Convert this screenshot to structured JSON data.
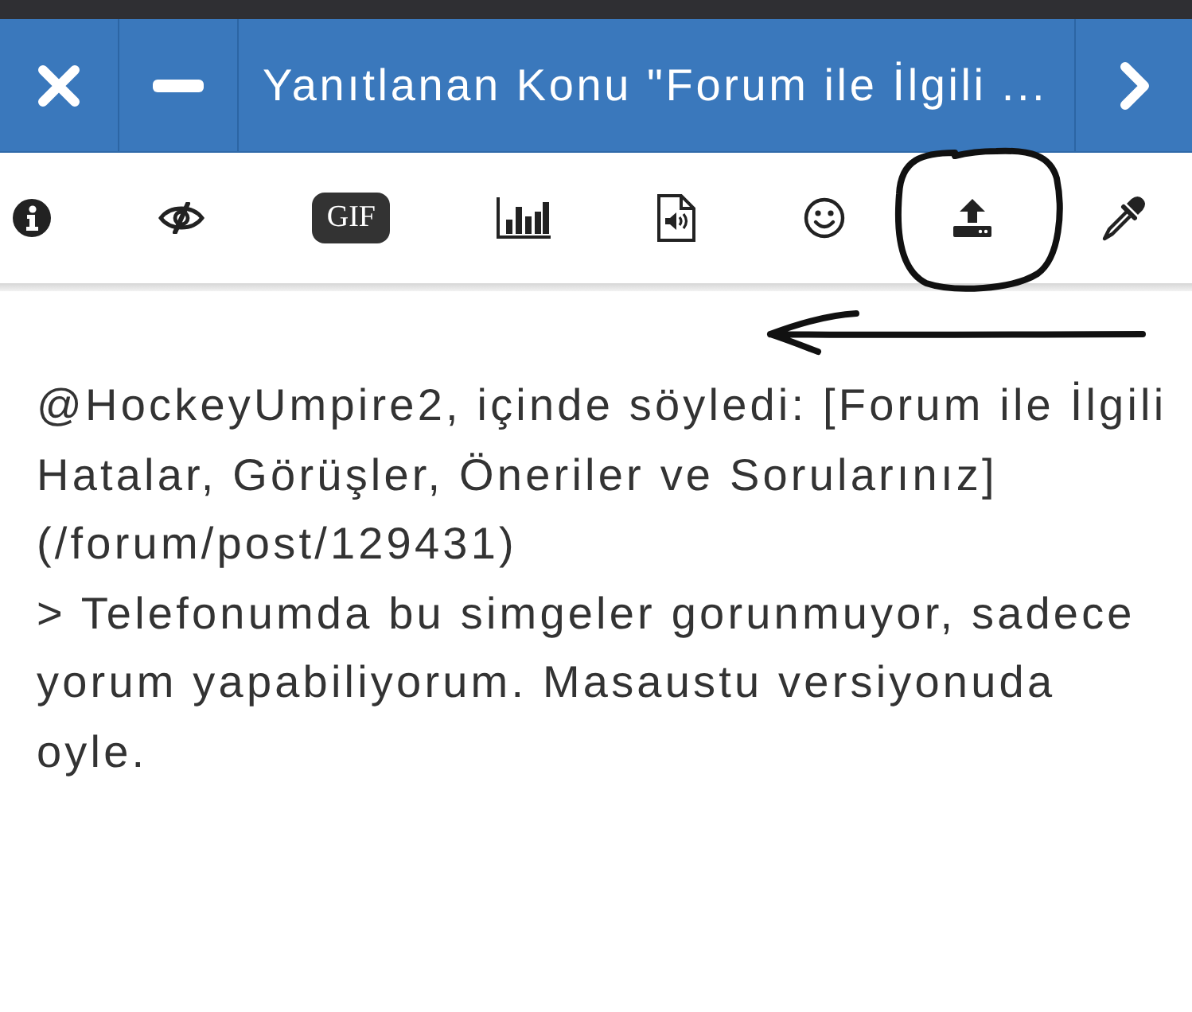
{
  "header": {
    "left_buttons": [
      {
        "kind": "close"
      },
      {
        "kind": "minimize"
      }
    ],
    "title": "Yanıtlanan Konu \"Forum ile İlgili ...",
    "right_buttons": [
      {
        "kind": "next"
      }
    ]
  },
  "toolbar": {
    "items": [
      {
        "kind": "info",
        "circled": false
      },
      {
        "kind": "hide",
        "circled": false
      },
      {
        "kind": "gif",
        "label": "GIF",
        "circled": false
      },
      {
        "kind": "poll",
        "circled": false
      },
      {
        "kind": "audio",
        "circled": false
      },
      {
        "kind": "emoji",
        "circled": false
      },
      {
        "kind": "upload",
        "circled": true
      },
      {
        "kind": "eyedropper",
        "circled": false
      }
    ]
  },
  "annotations": [
    {
      "kind": "arrow"
    }
  ],
  "message": {
    "value": "@HockeyUmpire2, içinde söyledi: [Forum ile İlgili Hatalar, Görüşler, Öneriler ve Sorularınız](/forum/post/129431)\n> Telefonumda bu simgeler gorunmuyor, sadece yorum yapabiliyorum. Masaustu versiyonuda oyle."
  }
}
